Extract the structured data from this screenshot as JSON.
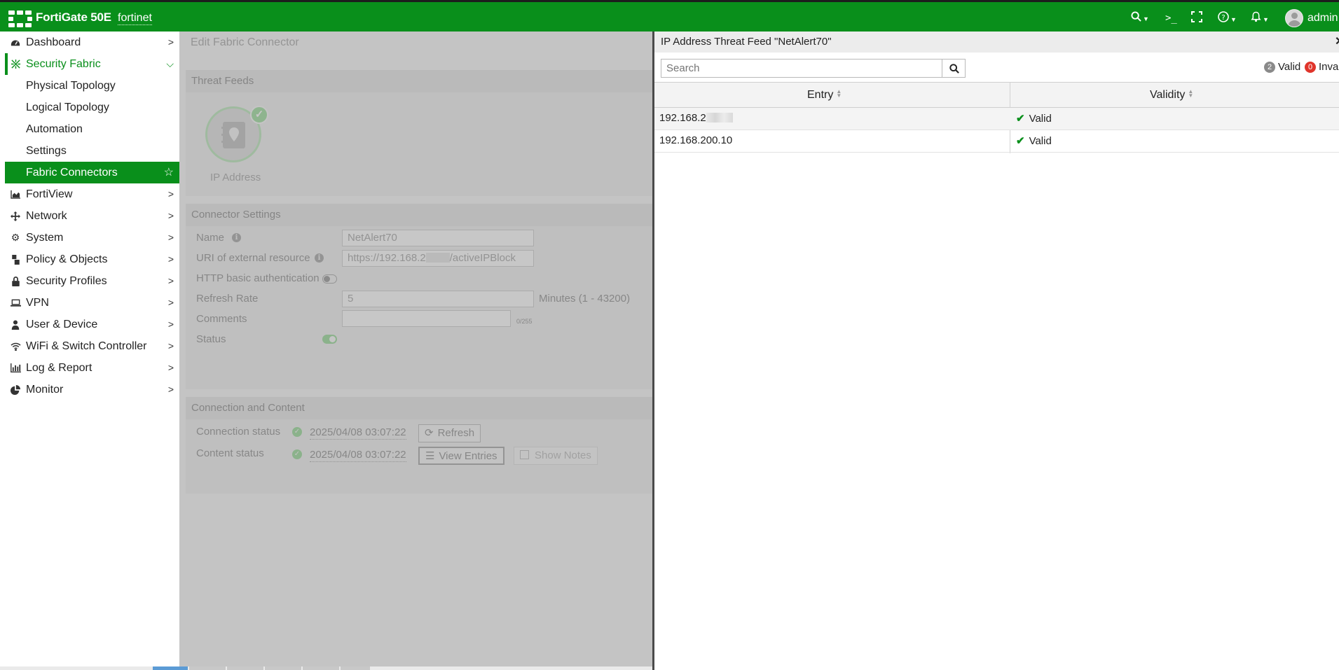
{
  "topbar": {
    "brand": "FortiGate 50E",
    "hostname": "fortinet",
    "user": "admin",
    "icons": [
      "search-icon",
      "terminal-icon",
      "fullscreen-icon",
      "help-icon",
      "bell-icon",
      "avatar-icon"
    ]
  },
  "sidebar": {
    "items": [
      {
        "label": "Dashboard",
        "icon": "dashboard-icon"
      },
      {
        "label": "Security Fabric",
        "icon": "security-fabric-icon",
        "expanded": true
      },
      {
        "label": "Physical Topology"
      },
      {
        "label": "Logical Topology"
      },
      {
        "label": "Automation"
      },
      {
        "label": "Settings"
      },
      {
        "label": "Fabric Connectors",
        "active": true
      },
      {
        "label": "FortiView",
        "icon": "chart-area-icon"
      },
      {
        "label": "Network",
        "icon": "network-icon"
      },
      {
        "label": "System",
        "icon": "gear-icon"
      },
      {
        "label": "Policy & Objects",
        "icon": "policy-icon"
      },
      {
        "label": "Security Profiles",
        "icon": "lock-icon"
      },
      {
        "label": "VPN",
        "icon": "laptop-icon"
      },
      {
        "label": "User & Device",
        "icon": "user-icon"
      },
      {
        "label": "WiFi & Switch Controller",
        "icon": "wifi-icon"
      },
      {
        "label": "Log & Report",
        "icon": "bar-chart-icon"
      },
      {
        "label": "Monitor",
        "icon": "pie-chart-icon"
      }
    ]
  },
  "main": {
    "title": "Edit Fabric Connector",
    "threat_feeds": {
      "heading": "Threat Feeds",
      "connector_label": "IP Address"
    },
    "connector_settings": {
      "heading": "Connector Settings",
      "name_label": "Name",
      "name_value": "NetAlert70",
      "uri_label": "URI of external resource",
      "uri_prefix": "https://192.168.2",
      "uri_suffix": "/activeIPBlock",
      "auth_label": "HTTP basic authentication",
      "refresh_label": "Refresh Rate",
      "refresh_value": "5",
      "refresh_unit": "Minutes (1 - 43200)",
      "comments_label": "Comments",
      "comments_counter": "0/255",
      "status_label": "Status"
    },
    "connection": {
      "heading": "Connection and Content",
      "conn_label": "Connection status",
      "conn_time": "2025/04/08 03:07:22",
      "refresh_button": "Refresh",
      "content_label": "Content status",
      "content_time": "2025/04/08 03:07:22",
      "view_button": "View Entries",
      "notes_button": "Show Notes"
    }
  },
  "panel": {
    "title": "IP Address Threat Feed \"NetAlert70\"",
    "close": "✕",
    "search_placeholder": "Search",
    "valid_count": "2",
    "valid_label": "Valid",
    "invalid_count": "0",
    "invalid_label": "Invalid",
    "columns": {
      "entry": "Entry",
      "validity": "Validity"
    },
    "rows": [
      {
        "entry": "192.168.2",
        "validity": "Valid",
        "redacted": true
      },
      {
        "entry": "192.168.200.10",
        "validity": "Valid"
      }
    ]
  },
  "colors": {
    "brand_green": "#098f1b",
    "panel_border": "#4a4a4a",
    "invalid_red": "#e0352b"
  }
}
